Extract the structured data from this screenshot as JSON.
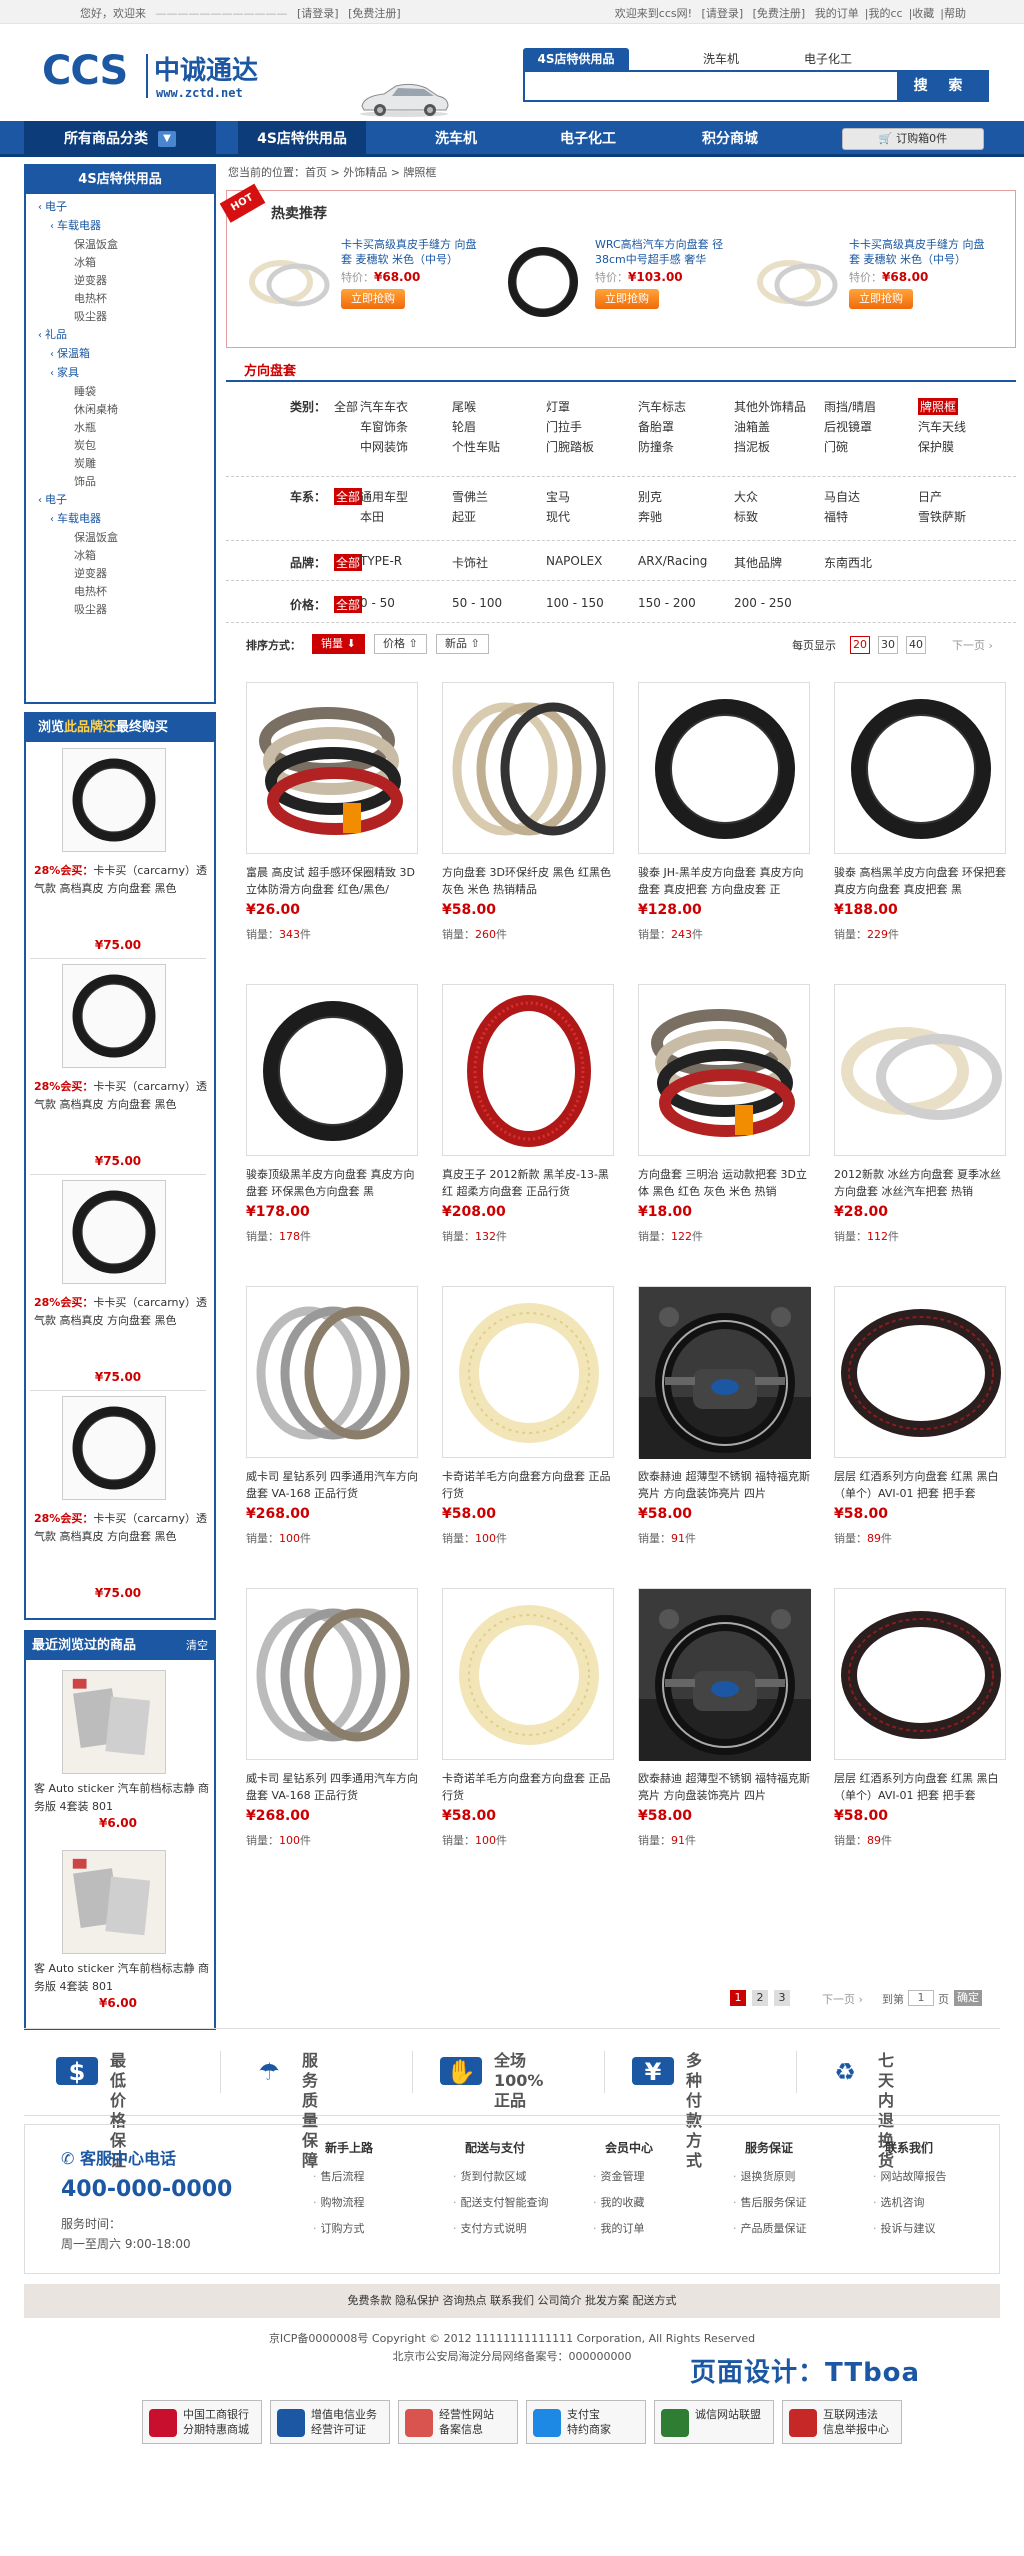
{
  "topbar": {
    "hello": "您好，欢迎来",
    "login": "[请登录]",
    "register": "[免费注册]",
    "right_welcome": "欢迎来到ccs网!",
    "right_login": "[请登录]",
    "right_register": "[免费注册]",
    "orders": "我的订单",
    "mine": "我的cc",
    "fav": "收藏",
    "help": "帮助"
  },
  "logo": {
    "brand": "CCS",
    "cn": "中诚通达",
    "url": "www.zctd.net"
  },
  "search": {
    "tabs": [
      "4S店特供用品",
      "洗车机",
      "电子化工"
    ],
    "placeholder": "",
    "button": "搜 索"
  },
  "nav": {
    "category": "所有商品分类",
    "items": [
      "4S店特供用品",
      "洗车机",
      "电子化工",
      "积分商城"
    ],
    "cart": "订购箱0件"
  },
  "left": {
    "tree_title": "4S店特供用品",
    "tree": [
      {
        "t": "l1",
        "ch": "‹",
        "label": "电子"
      },
      {
        "t": "l2",
        "ch": "‹",
        "label": "车载电器"
      },
      {
        "t": "l3",
        "label": "保温饭盒"
      },
      {
        "t": "l3",
        "label": "冰箱"
      },
      {
        "t": "l3",
        "label": "逆变器"
      },
      {
        "t": "l3",
        "label": "电热杯"
      },
      {
        "t": "l3",
        "label": "吸尘器"
      },
      {
        "t": "l1",
        "ch": "‹",
        "label": "礼品"
      },
      {
        "t": "l2",
        "ch": "‹",
        "label": "保温箱"
      },
      {
        "t": "l2",
        "ch": "‹",
        "label": "家具"
      },
      {
        "t": "l3",
        "label": "睡袋"
      },
      {
        "t": "l3",
        "label": "休闲桌椅"
      },
      {
        "t": "l3",
        "label": "水瓶"
      },
      {
        "t": "l3",
        "label": "炭包"
      },
      {
        "t": "l3",
        "label": "炭雕"
      },
      {
        "t": "l3",
        "label": "饰品"
      },
      {
        "t": "l1",
        "ch": "‹",
        "label": "电子"
      },
      {
        "t": "l2",
        "ch": "‹",
        "label": "车载电器"
      },
      {
        "t": "l3",
        "label": "保温饭盒"
      },
      {
        "t": "l3",
        "label": "冰箱"
      },
      {
        "t": "l3",
        "label": "逆变器"
      },
      {
        "t": "l3",
        "label": "电热杯"
      },
      {
        "t": "l3",
        "label": "吸尘器"
      }
    ],
    "browse_title_a": "浏览",
    "browse_title_b": "此品牌还",
    "browse_title_c": "最终购买",
    "browse": [
      {
        "hot": "28%会买：",
        "name": "卡卡买（carcarny）透气款 高档真皮 方向盘套 黑色",
        "price": "¥75.00"
      },
      {
        "hot": "28%会买：",
        "name": "卡卡买（carcarny）透气款 高档真皮 方向盘套 黑色",
        "price": "¥75.00"
      },
      {
        "hot": "28%会买：",
        "name": "卡卡买（carcarny）透气款 高档真皮 方向盘套 黑色",
        "price": "¥75.00"
      },
      {
        "hot": "28%会买：",
        "name": "卡卡买（carcarny）透气款 高档真皮 方向盘套 黑色",
        "price": "¥75.00"
      }
    ],
    "recent_title": "最近浏览过的商品",
    "recent_clear": "清空",
    "recent": [
      {
        "name": "客 Auto sticker 汽车前档标志静 商务版 4套装 801",
        "price": "¥6.00"
      },
      {
        "name": "客 Auto sticker 汽车前档标志静 商务版 4套装 801",
        "price": "¥6.00"
      }
    ]
  },
  "crumb": "您当前的位置：首页 > 外饰精品 > 牌照框",
  "hot": {
    "ribbon": "HOT",
    "title": "热卖推荐",
    "items": [
      {
        "name": "卡卡买高级真皮手缝方 向盘套 麦穗软 米色（中号）",
        "old": "特价：",
        "price": "¥68.00",
        "buy": "立即抢购"
      },
      {
        "name": "WRC高档汽车方向盘套 径38cm中号超手感 奢华",
        "old": "特价：",
        "price": "¥103.00",
        "buy": "立即抢购"
      },
      {
        "name": "卡卡买高级真皮手缝方 向盘套 麦穗软 米色（中号）",
        "old": "特价：",
        "price": "¥68.00",
        "buy": "立即抢购"
      }
    ]
  },
  "filter": {
    "title": "方向盘套",
    "category_label": "类别：",
    "category_all": "全部",
    "category": [
      [
        "汽车车衣",
        "尾喉",
        "灯罩",
        "汽车标志",
        "其他外饰精品",
        "雨挡/晴眉",
        "牌照框"
      ],
      [
        "车窗饰条",
        "轮眉",
        "门拉手",
        "备胎罩",
        "油箱盖",
        "后视镜罩",
        "汽车天线"
      ],
      [
        "中网装饰",
        "个性车贴",
        "门腕踏板",
        "防撞条",
        "挡泥板",
        "门碗",
        "保护膜"
      ]
    ],
    "series_label": "车系：",
    "series_all": "全部",
    "series": [
      [
        "通用车型",
        "雪佛兰",
        "宝马",
        "别克",
        "大众",
        "马自达",
        "日产"
      ],
      [
        "本田",
        "起亚",
        "现代",
        "奔驰",
        "标致",
        "福特",
        "雪铁萨斯"
      ]
    ],
    "brand_label": "品牌：",
    "brand_all": "全部",
    "brand": [
      "TYPE-R",
      "卡饰社",
      "NAPOLEX",
      "ARX/Racing",
      "其他品牌",
      "东南西北"
    ],
    "price_label": "价格：",
    "price_all": "全部",
    "price": [
      "0 - 50",
      "50 - 100",
      "100 - 150",
      "150 - 200",
      "200 - 250"
    ]
  },
  "sort": {
    "label": "排序方式：",
    "by": [
      "销量",
      "价格",
      "新品"
    ],
    "per_page": "每页显示",
    "sizes": [
      "20",
      "30",
      "40"
    ],
    "next": "下一页"
  },
  "products": [
    {
      "name": "富晨 高皮试 超手感环保圈精致 3D立体防滑方向盘套 红色/黑色/",
      "price": "¥26.00",
      "sales_l": "销量：",
      "sales": "343",
      "unit": "件"
    },
    {
      "name": "方向盘套 3D环保纤皮 黑色 红黑色 灰色 米色 热销精品",
      "price": "¥58.00",
      "sales_l": "销量：",
      "sales": "260",
      "unit": "件"
    },
    {
      "name": "骏泰 JH-黑羊皮方向盘套 真皮方向盘套 真皮把套 方向盘皮套 正",
      "price": "¥128.00",
      "sales_l": "销量：",
      "sales": "243",
      "unit": "件"
    },
    {
      "name": "骏泰 高档黑羊皮方向盘套 环保把套 真皮方向盘套 真皮把套 黑",
      "price": "¥188.00",
      "sales_l": "销量：",
      "sales": "229",
      "unit": "件"
    },
    {
      "name": "骏泰顶级黑羊皮方向盘套 真皮方向盘套 环保黑色方向盘套 黑",
      "price": "¥178.00",
      "sales_l": "销量：",
      "sales": "178",
      "unit": "件"
    },
    {
      "name": "真皮王子 2012新款 黑羊皮-13-黑红 超柔方向盘套 正品行货",
      "price": "¥208.00",
      "sales_l": "销量：",
      "sales": "132",
      "unit": "件"
    },
    {
      "name": "方向盘套 三明治 运动款把套 3D立体 黑色 红色 灰色 米色 热销",
      "price": "¥18.00",
      "sales_l": "销量：",
      "sales": "122",
      "unit": "件"
    },
    {
      "name": "2012新款 冰丝方向盘套 夏季冰丝方向盘套 冰丝汽车把套 热销",
      "price": "¥28.00",
      "sales_l": "销量：",
      "sales": "112",
      "unit": "件"
    },
    {
      "name": "威卡司 星钻系列 四季通用汽车方向盘套 VA-168 正品行货",
      "price": "¥268.00",
      "sales_l": "销量：",
      "sales": "100",
      "unit": "件"
    },
    {
      "name": "卡奇诺羊毛方向盘套方向盘套 正品行货",
      "price": "¥58.00",
      "sales_l": "销量：",
      "sales": "100",
      "unit": "件"
    },
    {
      "name": "欧泰赫迪 超薄型不锈钢 福特福克斯亮片 方向盘装饰亮片 四片",
      "price": "¥58.00",
      "sales_l": "销量：",
      "sales": "91",
      "unit": "件"
    },
    {
      "name": "层层 红酒系列方向盘套 红黑 黑白（单个）AVI-01 把套 把手套",
      "price": "¥58.00",
      "sales_l": "销量：",
      "sales": "89",
      "unit": "件"
    },
    {
      "name": "威卡司 星钻系列 四季通用汽车方向盘套 VA-168 正品行货",
      "price": "¥268.00",
      "sales_l": "销量：",
      "sales": "100",
      "unit": "件"
    },
    {
      "name": "卡奇诺羊毛方向盘套方向盘套 正品行货",
      "price": "¥58.00",
      "sales_l": "销量：",
      "sales": "100",
      "unit": "件"
    },
    {
      "name": "欧泰赫迪 超薄型不锈钢 福特福克斯亮片 方向盘装饰亮片 四片",
      "price": "¥58.00",
      "sales_l": "销量：",
      "sales": "91",
      "unit": "件"
    },
    {
      "name": "层层 红酒系列方向盘套 红黑 黑白（单个）AVI-01 把套 把手套",
      "price": "¥58.00",
      "sales_l": "销量：",
      "sales": "89",
      "unit": "件"
    }
  ],
  "pager": {
    "pages": [
      "1",
      "2",
      "3"
    ],
    "next": "下一页",
    "goto": "到第",
    "page_value": "1",
    "unit": "页",
    "confirm": "确定"
  },
  "service": [
    {
      "a": "最低价格",
      "b": "保证"
    },
    {
      "a": "服务质量",
      "b": "保障"
    },
    {
      "a": "全场100%",
      "b": "正品"
    },
    {
      "a": "多种付款",
      "b": "方式"
    },
    {
      "a": "七天内退",
      "b": "换货"
    }
  ],
  "contact": {
    "title": "客服中心电话",
    "tel": "400-000-0000",
    "hours_label": "服务时间：",
    "hours": "周一至周六 9:00-18:00"
  },
  "footer_cols": [
    {
      "h": "新手上路",
      "items": [
        "售后流程",
        "购物流程",
        "订购方式"
      ]
    },
    {
      "h": "配送与支付",
      "items": [
        "货到付款区域",
        "配送支付智能查询",
        "支付方式说明"
      ]
    },
    {
      "h": "会员中心",
      "items": [
        "资金管理",
        "我的收藏",
        "我的订单"
      ]
    },
    {
      "h": "服务保证",
      "items": [
        "退换货原则",
        "售后服务保证",
        "产品质量保证"
      ]
    },
    {
      "h": "联系我们",
      "items": [
        "网站故障报告",
        "选机咨询",
        "投诉与建议"
      ]
    }
  ],
  "fbar": "免费条款  隐私保护  咨询热点  联系我们  公司简介  批发方案  配送方式",
  "copyright": "京ICP备0000008号  Copyright © 2012 11111111111111 Corporation, All Rights Reserved",
  "police": "北京市公安局海淀分局网络备案号：000000000",
  "design": "页面设计：TTboa",
  "badges": [
    {
      "a": "中国工商银行",
      "b": "分期特惠商城",
      "color": "#c8102e"
    },
    {
      "a": "增值电信业务",
      "b": "经营许可证",
      "color": "#1b57a2"
    },
    {
      "a": "经营性网站",
      "b": "备案信息",
      "color": "#d9534f"
    },
    {
      "a": "支付宝",
      "b": "特约商家",
      "color": "#1e88e5"
    },
    {
      "a": "诚信网站联盟",
      "b": "",
      "color": "#2e7d32"
    },
    {
      "a": "互联网违法",
      "b": "信息举报中心",
      "color": "#c62828"
    }
  ]
}
